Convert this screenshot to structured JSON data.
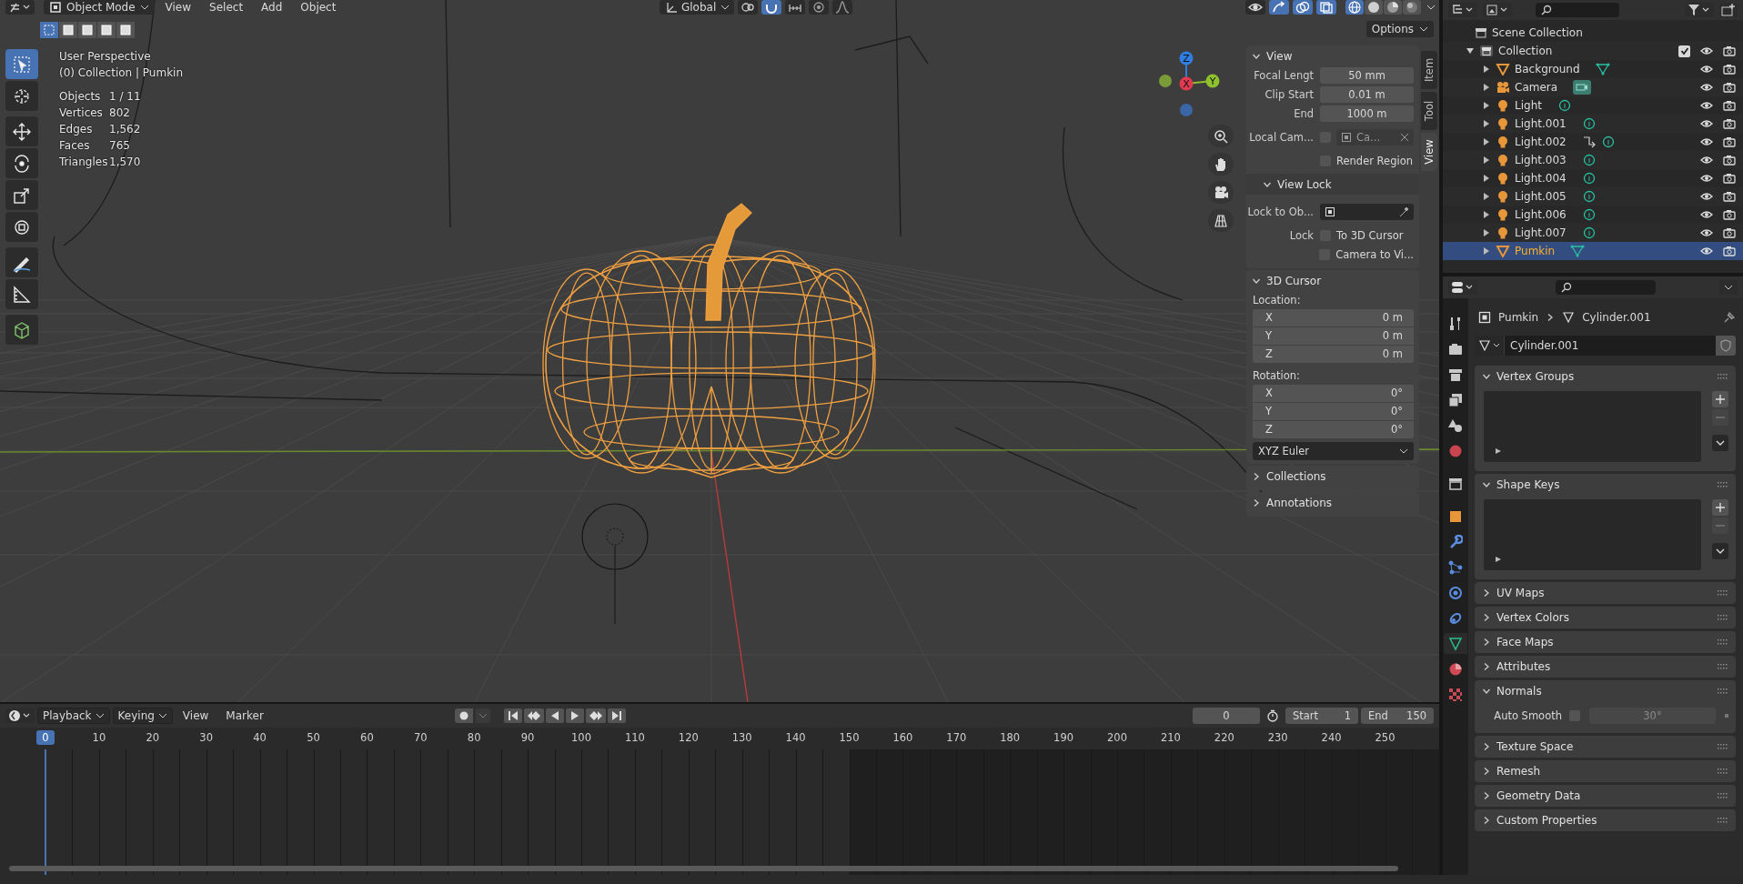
{
  "header": {
    "mode": "Object Mode",
    "menus": [
      {
        "label": "View"
      },
      {
        "label": "Select"
      },
      {
        "label": "Add"
      },
      {
        "label": "Object"
      }
    ],
    "orientation": "Global",
    "tools": [
      {
        "kind": "pivot",
        "on": false
      },
      {
        "kind": "snap",
        "on": true
      },
      {
        "kind": "increment",
        "on": false
      },
      {
        "kind": "proportional",
        "on": false
      },
      {
        "kind": "falloff",
        "on": false
      }
    ],
    "toggles": [
      {
        "kind": "visibility",
        "on": false
      },
      {
        "kind": "gizmo",
        "on": true
      },
      {
        "kind": "overlay",
        "on": true
      },
      {
        "kind": "xray",
        "on": true
      }
    ],
    "shading": [
      {
        "kind": "wireframe",
        "selected": true
      },
      {
        "kind": "solid",
        "selected": false
      },
      {
        "kind": "material",
        "selected": false
      },
      {
        "kind": "rendered",
        "selected": false
      }
    ],
    "options": "Options"
  },
  "select_modes": [
    {
      "selected": true
    },
    {
      "selected": false
    },
    {
      "selected": false
    },
    {
      "selected": false
    },
    {
      "selected": false
    }
  ],
  "toolbar": [
    {
      "kind": "select",
      "selected": true
    },
    {
      "kind": "cursor",
      "selected": false
    },
    {
      "kind": "move",
      "selected": false
    },
    {
      "kind": "rotate",
      "selected": false
    },
    {
      "kind": "scale",
      "selected": false
    },
    {
      "kind": "transform",
      "selected": false
    },
    {
      "kind": "annotate",
      "selected": false
    },
    {
      "kind": "measure",
      "selected": false
    },
    {
      "kind": "add",
      "selected": false
    }
  ],
  "info": {
    "view": "User Perspective",
    "context": "(0) Collection | Pumkin",
    "stats": [
      {
        "label": "Objects",
        "value": "1 / 11"
      },
      {
        "label": "Vertices",
        "value": "802"
      },
      {
        "label": "Edges",
        "value": "1,562"
      },
      {
        "label": "Faces",
        "value": "765"
      },
      {
        "label": "Triangles",
        "value": "1,570"
      }
    ]
  },
  "gizmo": {
    "axes": [
      {
        "label": "Z",
        "color": "#2f7ee0"
      },
      {
        "label": "X",
        "color": "#e23a50"
      },
      {
        "label": "Y",
        "color": "#8fc12e"
      }
    ]
  },
  "sidebar": {
    "tabs": [
      {
        "label": "Item",
        "selected": false
      },
      {
        "label": "Tool",
        "selected": false
      },
      {
        "label": "View",
        "selected": true
      }
    ],
    "view_panel": {
      "title": "View",
      "expanded": true,
      "fields": [
        {
          "label": "Focal Lengt",
          "value": "50 mm"
        },
        {
          "label": "Clip Start",
          "value": "0.01 m"
        },
        {
          "label": "End",
          "value": "1000 m"
        }
      ],
      "local_camera": {
        "label": "Local Cam...",
        "checked": false,
        "value": "Ca..."
      },
      "render_region": {
        "label": "Render Region",
        "checked": false
      },
      "view_lock": {
        "title": "View Lock",
        "expanded": true,
        "lock_object_label": "Lock to Ob...",
        "lock_label": "Lock",
        "options": [
          {
            "label": "To 3D Cursor",
            "checked": false
          },
          {
            "label": "Camera to Vi...",
            "checked": false
          }
        ]
      }
    },
    "cursor_panel": {
      "title": "3D Cursor",
      "expanded": true,
      "location_label": "Location:",
      "location": [
        {
          "axis": "X",
          "value": "0 m"
        },
        {
          "axis": "Y",
          "value": "0 m"
        },
        {
          "axis": "Z",
          "value": "0 m"
        }
      ],
      "rotation_label": "Rotation:",
      "rotation": [
        {
          "axis": "X",
          "value": "0°"
        },
        {
          "axis": "Y",
          "value": "0°"
        },
        {
          "axis": "Z",
          "value": "0°"
        }
      ],
      "rotation_mode": "XYZ Euler"
    },
    "collapsed_panels": [
      {
        "title": "Collections",
        "expanded": false
      },
      {
        "title": "Annotations",
        "expanded": false
      }
    ]
  },
  "outliner": {
    "scene": "Scene Collection",
    "collection": {
      "name": "Collection",
      "expanded": true,
      "checked": true
    },
    "objects": [
      {
        "name": "Background",
        "kind": "mesh",
        "constrained": false,
        "selected": false
      },
      {
        "name": "Camera",
        "kind": "camera",
        "constrained": false,
        "selected": false
      },
      {
        "name": "Light",
        "kind": "light",
        "constrained": false,
        "selected": false
      },
      {
        "name": "Light.001",
        "kind": "light",
        "constrained": false,
        "selected": false
      },
      {
        "name": "Light.002",
        "kind": "light",
        "constrained": true,
        "selected": false
      },
      {
        "name": "Light.003",
        "kind": "light",
        "constrained": false,
        "selected": false
      },
      {
        "name": "Light.004",
        "kind": "light",
        "constrained": false,
        "selected": false
      },
      {
        "name": "Light.005",
        "kind": "light",
        "constrained": false,
        "selected": false
      },
      {
        "name": "Light.006",
        "kind": "light",
        "constrained": false,
        "selected": false
      },
      {
        "name": "Light.007",
        "kind": "light",
        "constrained": false,
        "selected": false
      },
      {
        "name": "Pumkin",
        "kind": "mesh",
        "constrained": false,
        "selected": true
      }
    ]
  },
  "properties": {
    "tabs": [
      {
        "kind": "tool",
        "selected": false
      },
      {
        "kind": "render",
        "selected": false
      },
      {
        "kind": "output",
        "selected": false
      },
      {
        "kind": "view_layer",
        "selected": false
      },
      {
        "kind": "scene",
        "selected": false
      },
      {
        "kind": "world",
        "selected": false
      },
      {
        "kind": "collection",
        "selected": false
      },
      {
        "kind": "object",
        "selected": false
      },
      {
        "kind": "modifiers",
        "selected": false
      },
      {
        "kind": "particles",
        "selected": false
      },
      {
        "kind": "physics",
        "selected": false
      },
      {
        "kind": "constraints",
        "selected": false
      },
      {
        "kind": "data",
        "selected": true
      },
      {
        "kind": "material",
        "selected": false
      },
      {
        "kind": "texture",
        "selected": false
      }
    ],
    "object": "Pumkin",
    "data": "Cylinder.001",
    "data_field": "Cylinder.001",
    "panels": [
      {
        "title": "Vertex Groups",
        "kind": "list",
        "expanded": true
      },
      {
        "title": "Shape Keys",
        "kind": "list",
        "expanded": true
      },
      {
        "title": "UV Maps",
        "expanded": false
      },
      {
        "title": "Vertex Colors",
        "expanded": false
      },
      {
        "title": "Face Maps",
        "expanded": false
      },
      {
        "title": "Attributes",
        "expanded": false
      },
      {
        "title": "Normals",
        "kind": "normals",
        "expanded": true,
        "label": "Auto Smooth",
        "checked": false,
        "angle": "30°"
      },
      {
        "title": "Texture Space",
        "expanded": false
      },
      {
        "title": "Remesh",
        "expanded": false
      },
      {
        "title": "Geometry Data",
        "expanded": false
      },
      {
        "title": "Custom Properties",
        "expanded": false
      }
    ]
  },
  "timeline": {
    "menus": [
      {
        "label": "Playback",
        "kind": "dropdown"
      },
      {
        "label": "Keying",
        "kind": "dropdown"
      },
      {
        "label": "View",
        "kind": "menu"
      },
      {
        "label": "Marker",
        "kind": "menu"
      }
    ],
    "current_frame": "0",
    "start_label": "Start",
    "start": "1",
    "end_label": "End",
    "end": "150",
    "playhead": "0",
    "ruler": [
      "10",
      "20",
      "30",
      "40",
      "50",
      "60",
      "70",
      "80",
      "90",
      "100",
      "110",
      "120",
      "130",
      "140",
      "150",
      "160",
      "170",
      "180",
      "190",
      "200",
      "210",
      "220",
      "230",
      "240",
      "250"
    ]
  }
}
